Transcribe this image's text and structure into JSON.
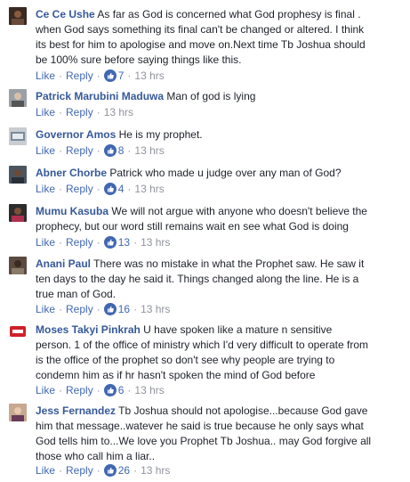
{
  "actions": {
    "like": "Like",
    "reply": "Reply",
    "sep": "·"
  },
  "colors": {
    "name": "#365899",
    "link": "#4267b2",
    "meta": "#90949c",
    "text": "#1d2129"
  },
  "comments": [
    {
      "author": "Ce Ce Ushe",
      "lines": [
        "As far as God is concerned what God prophesy is final .",
        "when God says something its final can't be changed or altered. I think",
        "its best for him to apologise and move on.Next time Tb Joshua should",
        "be 100% sure before saying things like this."
      ],
      "reactions": "7",
      "time": "13 hrs"
    },
    {
      "author": "Patrick Marubini Maduwa",
      "lines": [
        "Man of god is lying"
      ],
      "reactions": "",
      "time": "13 hrs"
    },
    {
      "author": "Governor Amos",
      "lines": [
        "He is my prophet."
      ],
      "reactions": "8",
      "time": "13 hrs"
    },
    {
      "author": "Abner Chorbe",
      "lines": [
        "Patrick who made u judge over any man of God?"
      ],
      "reactions": "4",
      "time": "13 hrs"
    },
    {
      "author": "Mumu Kasuba",
      "lines": [
        "We will not argue with anyone who doesn't believe the",
        "prophecy, but our word still remains wait en see what God is doing"
      ],
      "reactions": "13",
      "time": "13 hrs"
    },
    {
      "author": "Anani Paul",
      "lines": [
        "There was no mistake in what the Prophet saw. He saw it",
        "ten days to the day he said it. Things changed along the line. He is a",
        "true man of God."
      ],
      "reactions": "16",
      "time": "13 hrs"
    },
    {
      "author": "Moses Takyi Pinkrah",
      "lines": [
        "U have spoken like a mature n sensitive",
        "person. 1 of the office of ministry which I'd very difficult to operate from",
        "is the office of the prophet so don't see why people are trying to",
        "condemn him as if hr hasn't spoken the mind of God before"
      ],
      "reactions": "6",
      "time": "13 hrs"
    },
    {
      "author": "Jess Fernandez",
      "lines": [
        "Tb Joshua should not apologise...because God gave",
        "him that message..watever he said is true because he only says what",
        "God tells him to...We love you Prophet Tb Joshua.. may God forgive all",
        "those who call him a liar.."
      ],
      "reactions": "26",
      "time": "13 hrs"
    }
  ]
}
